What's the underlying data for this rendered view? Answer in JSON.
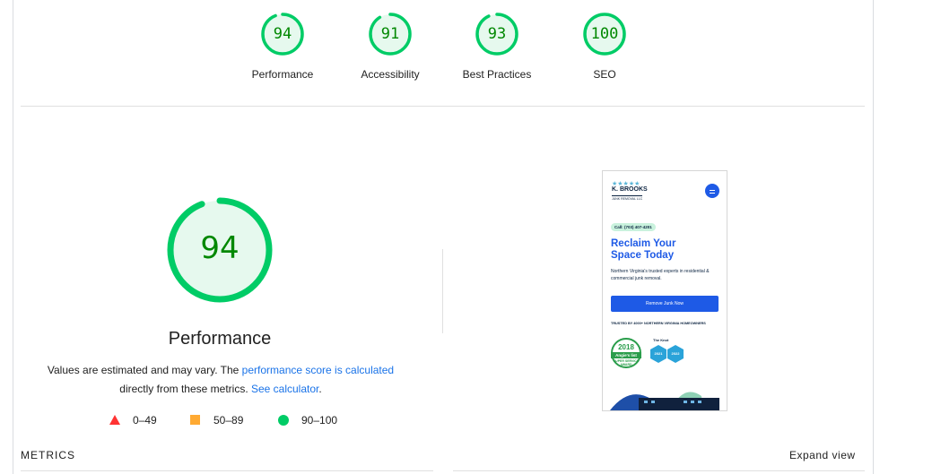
{
  "gauges": [
    {
      "label": "Performance",
      "score": "94",
      "value": 94
    },
    {
      "label": "Accessibility",
      "score": "91",
      "value": 91
    },
    {
      "label": "Best Practices",
      "score": "93",
      "value": 93
    },
    {
      "label": "SEO",
      "score": "100",
      "value": 100
    }
  ],
  "main_gauge": {
    "score": "94",
    "value": 94,
    "title": "Performance"
  },
  "description": {
    "part1": "Values are estimated and may vary. The ",
    "link1": "performance score is calculated",
    "part2": "directly from these metrics. ",
    "link2": "See calculator",
    "part3": "."
  },
  "legend": [
    {
      "range": "0–49",
      "icon": "red-triangle-icon"
    },
    {
      "range": "50–89",
      "icon": "orange-square-icon"
    },
    {
      "range": "90–100",
      "icon": "green-circle-icon"
    }
  ],
  "colors": {
    "pass": "#00cc66",
    "pass_text": "#008800",
    "pass_fill": "#e6f9ee",
    "average": "#ffaa33",
    "fail": "#ff3333",
    "link": "#1a73e8"
  },
  "screenshot": {
    "stars": "★★★★★",
    "brand": "K. BROOKS",
    "brand_sub": "JUNK REMOVAL LLC",
    "call": "Call: (703) 407-4201",
    "hero": "Reclaim Your Space Today",
    "hero_sub": "Northern Virginia's trusted experts in residential & commercial junk removal.",
    "cta": "Remove Junk Now",
    "trusted": "TRUSTED BY 4000+ NORTHERN VIRGINIA HOMEOWNERS",
    "award_year": "2018",
    "award_name": "Angie's list",
    "award_sub": "SUPER SERVICE AWARD",
    "knot_label": "The Knot",
    "hex1": "2021",
    "hex2": "2022"
  },
  "metrics_label": "METRICS",
  "expand_label": "Expand view"
}
